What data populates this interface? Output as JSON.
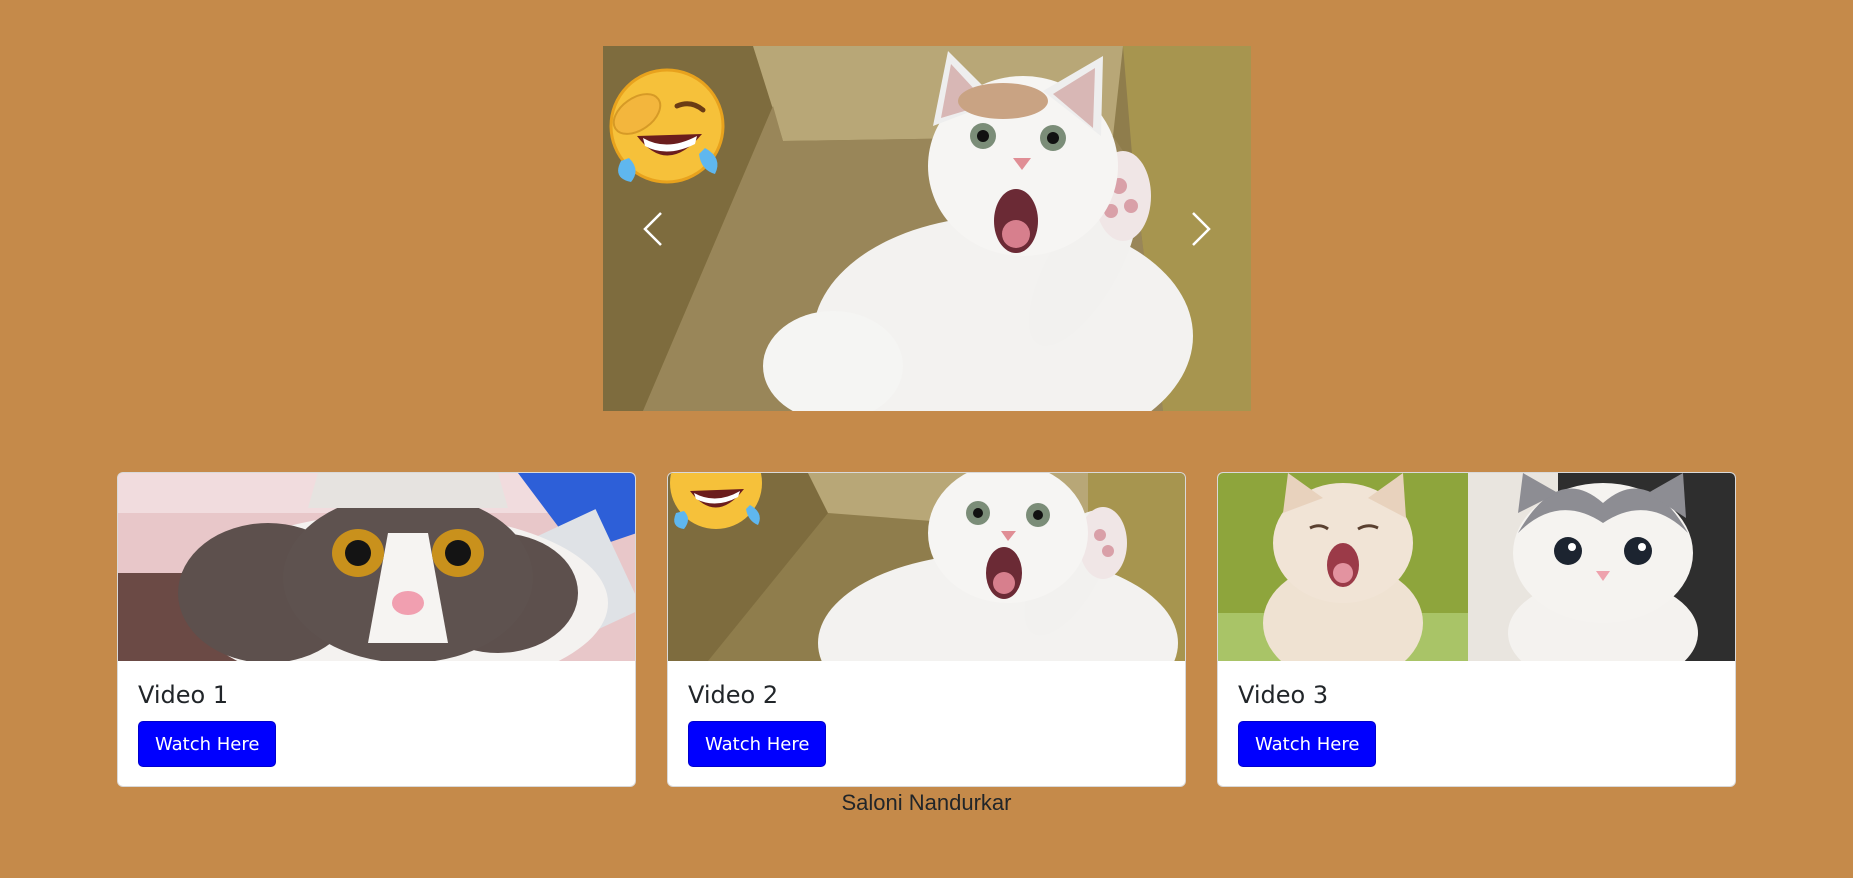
{
  "colors": {
    "background": "#c58a4a",
    "button": "#0000ff",
    "button_text": "#ffffff",
    "card_bg": "#ffffff"
  },
  "carousel": {
    "image": "white cat in cardboard box with laughing emoji",
    "prev_icon": "chevron-left-icon",
    "next_icon": "chevron-right-icon"
  },
  "cards": [
    {
      "image": "surprised grey and white cat wearing a paper hat",
      "title": "Video 1",
      "button_label": "Watch Here"
    },
    {
      "image": "white cat in cardboard box with laughing emoji",
      "title": "Video 2",
      "button_label": "Watch Here"
    },
    {
      "image": "two kittens, one yawning and one grey-and-white",
      "title": "Video 3",
      "button_label": "Watch Here"
    }
  ],
  "footer": {
    "author": "Saloni Nandurkar"
  }
}
